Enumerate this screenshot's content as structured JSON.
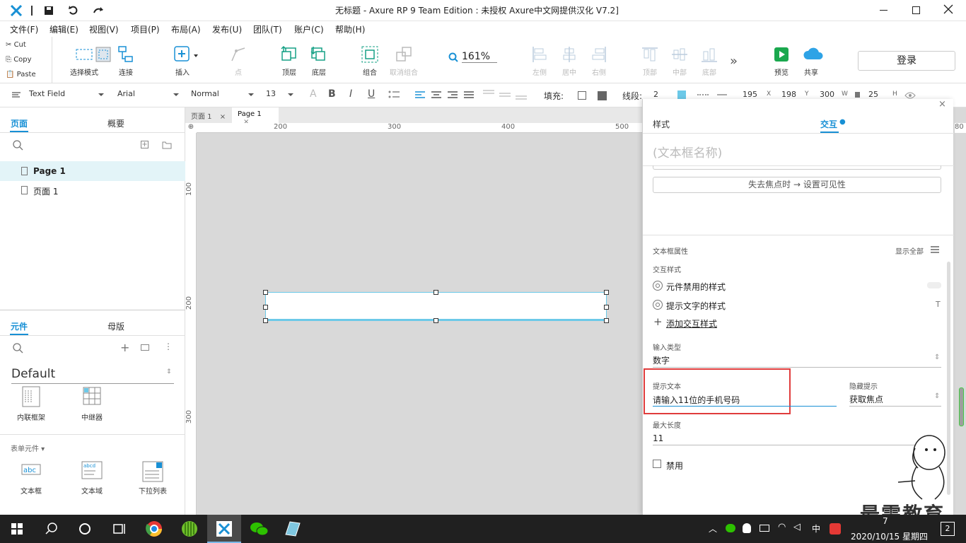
{
  "window": {
    "title": "无标题 - Axure RP 9 Team Edition : 未授权    Axure中文网提供汉化 V7.2]"
  },
  "menu": [
    "文件(F)",
    "编辑(E)",
    "视图(V)",
    "项目(P)",
    "布局(A)",
    "发布(U)",
    "团队(T)",
    "账户(C)",
    "帮助(H)"
  ],
  "clipboard": {
    "cut": "Cut",
    "copy": "Copy",
    "paste": "Paste"
  },
  "toolbar": {
    "select_mode": "选择模式",
    "connect": "连接",
    "insert": "插入",
    "point": "点",
    "top_layer": "顶层",
    "bottom_layer": "底层",
    "group": "组合",
    "ungroup": "取消组合",
    "zoom": "161%",
    "align_left": "左侧",
    "align_center": "居中",
    "align_right": "右侧",
    "align_top": "顶部",
    "align_middle": "中部",
    "align_bottom": "底部",
    "preview": "预览",
    "share": "共享",
    "login": "登录"
  },
  "format": {
    "widget_type": "Text Field",
    "font": "Arial",
    "weight": "Normal",
    "size": "13",
    "fill_label": "填充:",
    "line_label": "线段:",
    "line_width": "2",
    "x": "195",
    "x_label": "X",
    "y": "198",
    "y_label": "Y",
    "w": "300",
    "w_label": "W",
    "h": "25",
    "h_label": "H"
  },
  "pages_panel": {
    "tab_pages": "页面",
    "tab_outline": "概要",
    "pages": [
      "Page 1",
      "页面 1"
    ]
  },
  "widgets_panel": {
    "tab_widgets": "元件",
    "tab_masters": "母版",
    "library": "Default",
    "items1": [
      "内联框架",
      "中继器"
    ],
    "section": "表单元件 ▾",
    "items2": [
      "文本框",
      "文本域",
      "下拉列表"
    ]
  },
  "page_tabs": [
    "页面 1",
    "Page 1"
  ],
  "ruler_h": [
    "200",
    "300",
    "400",
    "500"
  ],
  "ruler_v": [
    "100",
    "200",
    "300"
  ],
  "inspector": {
    "tab_style": "样式",
    "tab_interactions": "交互",
    "name_placeholder": "(文本框名称)",
    "event_line": "失去焦点时 → 设置可见性",
    "props_title": "文本框属性",
    "show_all": "显示全部",
    "interaction_styles": "交互样式",
    "disabled_style": "元件禁用的样式",
    "hint_style": "提示文字的样式",
    "add_style": "添加交互样式",
    "input_type_label": "输入类型",
    "input_type": "数字",
    "hint_label": "提示文本",
    "hint_value": "请输入11位的手机号码",
    "hide_hint_label": "隐藏提示",
    "hide_hint_value": "获取焦点",
    "max_len_label": "最大长度",
    "max_len": "11",
    "disabled": "禁用"
  },
  "watermark": "最需教育",
  "taskbar": {
    "ime": "中",
    "time": "7",
    "date": "2020/10/15 星期四",
    "badge": "2"
  },
  "colors": {
    "accent": "#1890d5",
    "highlight": "#e03c3c",
    "textfield_border": "#6cc9e8"
  }
}
